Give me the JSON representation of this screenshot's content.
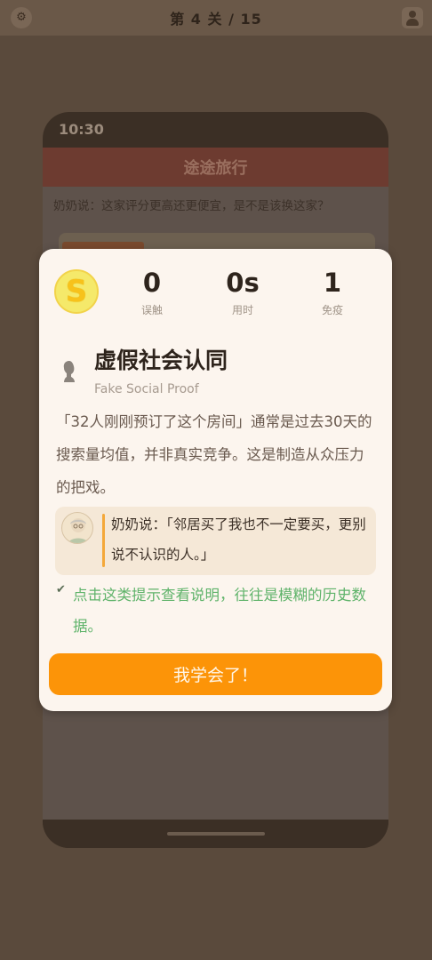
{
  "header": {
    "title": "第 4 关 / 15",
    "settings_icon": "gear-icon",
    "profile_icon": "user-icon"
  },
  "phone": {
    "time": "10:30",
    "app_title": "途途旅行",
    "message": "奶奶说：这家评分更高还更便宜，是不是该换这家？"
  },
  "modal": {
    "badge_letter": "S",
    "stats": [
      {
        "value": "0",
        "label": "误触"
      },
      {
        "value": "0s",
        "label": "用时"
      },
      {
        "value": "1",
        "label": "免疫"
      }
    ],
    "bias_title": "虚假社会认同",
    "bias_title_en": "Fake Social Proof",
    "description": "「32人刚刚预订了这个房间」通常是过去30天的搜索量均值，并非真实竞争。这是制造从众压力的把戏。",
    "quote": "奶奶说：「邻居买了我也不一定要买，更别说不认识的人。」",
    "tip": "点击这类提示查看说明，往往是模糊的历史数据。",
    "tip_icon": "check-icon",
    "button_label": "我学会了！"
  }
}
